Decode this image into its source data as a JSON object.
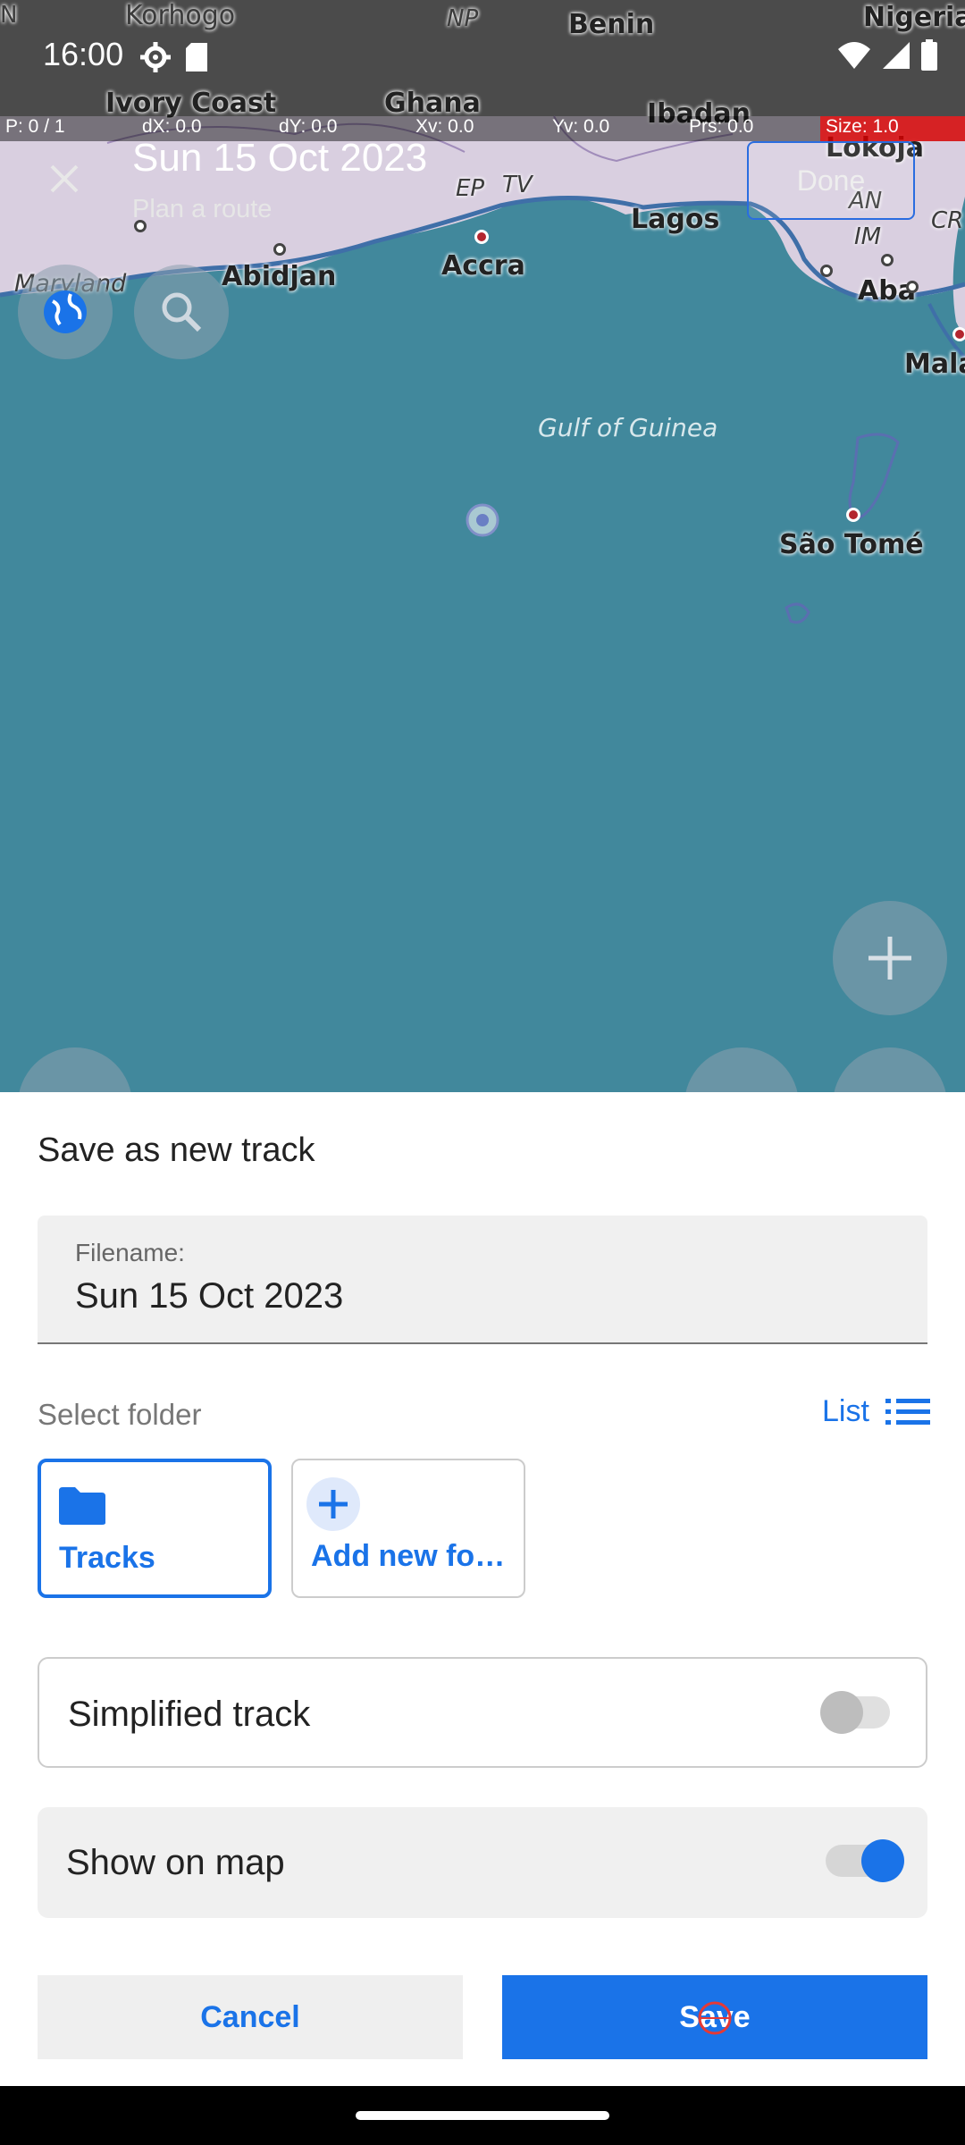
{
  "status_bar": {
    "time": "16:00"
  },
  "debug": [
    "P: 0 / 1",
    "dX: 0.0",
    "dY: 0.0",
    "Xv: 0.0",
    "Yv: 0.0",
    "Prs: 0.0",
    "Size: 1.0"
  ],
  "map": {
    "labels": {
      "ivory_coast": "Ivory Coast",
      "ghana": "Ghana",
      "benin": "Benin",
      "nigeria": "Nigeria",
      "ibadan": "Ibadan",
      "lagos": "Lagos",
      "accra": "Accra",
      "abidjan": "Abidjan",
      "maryland": "Maryland",
      "lokoja": "Lokoja",
      "aba": "Aba",
      "malabo": "Mala",
      "sao_tome": "São Tomé",
      "gulf": "Gulf of Guinea",
      "ep": "EP",
      "tv": "TV",
      "an": "AN",
      "im": "IM",
      "cr": "CR",
      "np": "NP",
      "n": "N",
      "kormogo": "Korhogo"
    }
  },
  "route_header": {
    "title": "Sun 15 Oct 2023",
    "subtitle": "Plan a route",
    "done_label": "Done"
  },
  "sheet": {
    "title": "Save as new track",
    "filename_label": "Filename:",
    "filename_value": "Sun 15 Oct 2023",
    "select_folder_label": "Select folder",
    "list_label": "List",
    "folders": [
      {
        "label": "Tracks",
        "selected": true
      },
      {
        "label": "Add new fo…",
        "selected": false
      }
    ],
    "simplified_track": {
      "label": "Simplified track",
      "enabled": false
    },
    "show_on_map": {
      "label": "Show on map",
      "enabled": true
    },
    "cancel_label": "Cancel",
    "save_label": "Save"
  },
  "colors": {
    "accent": "#1a73e8",
    "sea": "#41889c",
    "land": "#d9cfe0"
  }
}
